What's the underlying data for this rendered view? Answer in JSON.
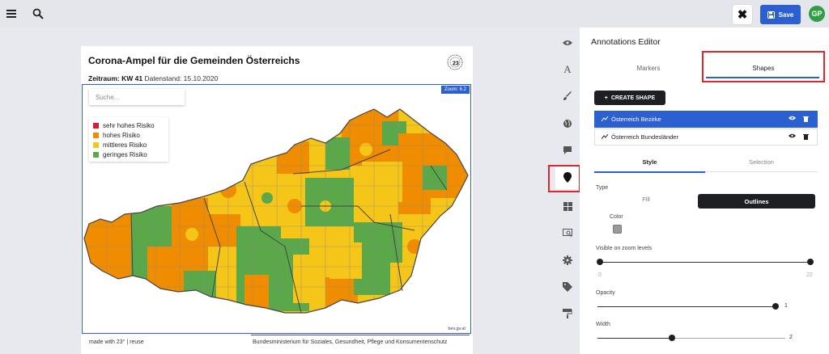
{
  "topbar": {
    "close_label": "✖",
    "save_label": "Save",
    "avatar_initials": "GP"
  },
  "panel": {
    "title": "Annotations Editor",
    "tabs": [
      {
        "label": "Markers"
      },
      {
        "label": "Shapes"
      }
    ],
    "create_label": "CREATE SHAPE",
    "layers": [
      {
        "label": "Österreich Bezirke"
      },
      {
        "label": "Österreich Bundesländer"
      }
    ],
    "subtabs": [
      {
        "label": "Style"
      },
      {
        "label": "Selection"
      }
    ],
    "type_label": "Type",
    "type_options": {
      "fill": "Fill",
      "outlines": "Outlines"
    },
    "color_label": "Color",
    "color_value": "#9a9a9a",
    "zoom_label": "Visible on zoom levels",
    "zoom_min": "0",
    "zoom_max": "22",
    "opacity_label": "Opacity",
    "opacity_value": "1",
    "width_label": "Width",
    "width_value": "2"
  },
  "card": {
    "title": "Corona-Ampel für die Gemeinden Österreichs",
    "period_label": "Zeitraum: KW 41",
    "date_label": "Datenstand: 15.10.2020",
    "zoom_badge": "Zoom: 6.2",
    "search_placeholder": "Suche...",
    "legend": [
      {
        "label": "sehr hohes Risiko",
        "color": "#d51c3d"
      },
      {
        "label": "hohes Risiko",
        "color": "#f08c00"
      },
      {
        "label": "mittleres Risiko",
        "color": "#f5c518"
      },
      {
        "label": "geringes Risiko",
        "color": "#5aa84a"
      }
    ],
    "source": "bev.gv.at",
    "footer_left": "made with 23° | reuse",
    "footer_right": "Bundesministerium für Soziales, Gesundheit, Pflege und Konsumentenschutz"
  },
  "icons": {
    "sidebar": [
      "eye-icon",
      "text-icon",
      "brush-icon",
      "globe-icon",
      "comment-icon",
      "marker-icon",
      "grid-icon",
      "screen-icon",
      "gear-icon",
      "tag-icon",
      "paint-roller-icon"
    ]
  }
}
